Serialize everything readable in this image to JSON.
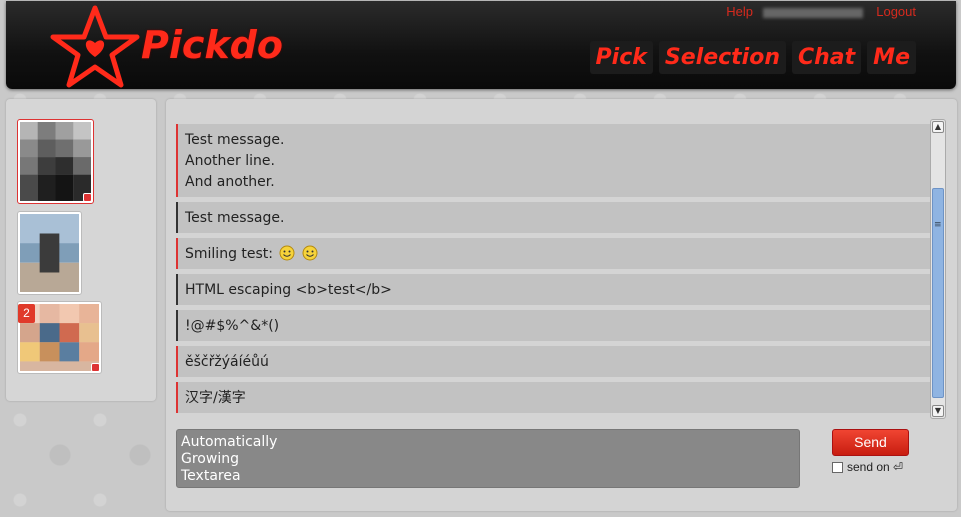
{
  "app": {
    "brand": "Pickdo",
    "colors": {
      "accent": "#ff2a1a",
      "header_bg": "#111111",
      "message_bg": "#c2c2c2",
      "send_button": "#e03a2a"
    }
  },
  "header": {
    "help_link": "Help",
    "logout_link": "Logout",
    "nav": [
      "Pick",
      "Selection",
      "Chat",
      "Me"
    ]
  },
  "sidebar": {
    "contacts": [
      {
        "active": true,
        "badge": "",
        "online": true
      },
      {
        "active": false,
        "badge": "",
        "online": false
      },
      {
        "active": false,
        "badge": "2",
        "online": true
      }
    ]
  },
  "chat": {
    "messages": [
      {
        "lines": [
          "Test message.",
          "Another line.",
          "And another."
        ],
        "side": "red"
      },
      {
        "lines": [
          "Test message."
        ],
        "side": "dark"
      },
      {
        "lines": [
          "Smiling test:"
        ],
        "side": "red",
        "emoticons": [
          "smile-emoticon",
          "smile-emoticon"
        ]
      },
      {
        "lines": [
          "HTML escaping <b>test</b>"
        ],
        "side": "dark"
      },
      {
        "lines": [
          "!@#$%^&*()"
        ],
        "side": "dark"
      },
      {
        "lines": [
          "ěščřžýáíéůú"
        ],
        "side": "red"
      },
      {
        "lines": [
          "汉字/漢字"
        ],
        "side": "red"
      }
    ],
    "composer": {
      "text": "Automatically\nGrowing\nTextarea",
      "send_label": "Send",
      "send_on_label": "send on ⏎"
    }
  }
}
